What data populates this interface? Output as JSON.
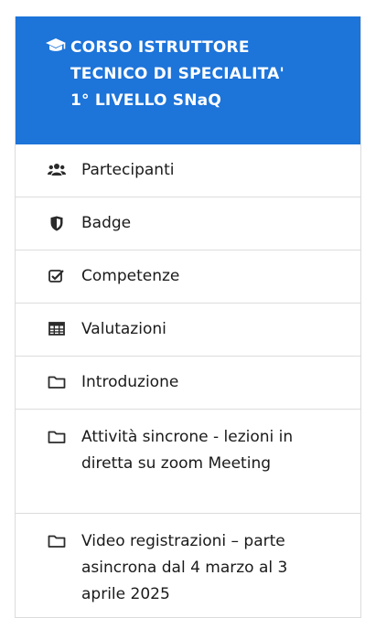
{
  "course": {
    "title": "CORSO ISTRUTTORE TECNICO DI SPECIALITA' 1° LIVELLO SNaQ",
    "icon": "graduation-cap-icon"
  },
  "nav": {
    "items": [
      {
        "label": "Partecipanti",
        "icon": "users-icon"
      },
      {
        "label": "Badge",
        "icon": "shield-icon"
      },
      {
        "label": "Competenze",
        "icon": "checkbox-icon"
      },
      {
        "label": "Valutazioni",
        "icon": "table-icon"
      },
      {
        "label": "Introduzione",
        "icon": "folder-icon"
      },
      {
        "label": "Attività sincrone - lezioni in diretta su zoom Meeting",
        "icon": "folder-icon"
      },
      {
        "label": "Video registrazioni – parte asincrona dal 4 marzo al 3 aprile 2025",
        "icon": "folder-icon"
      }
    ]
  },
  "colors": {
    "accent": "#1d74d9",
    "text": "#1a1a1a",
    "divider": "#dcdcdc"
  }
}
